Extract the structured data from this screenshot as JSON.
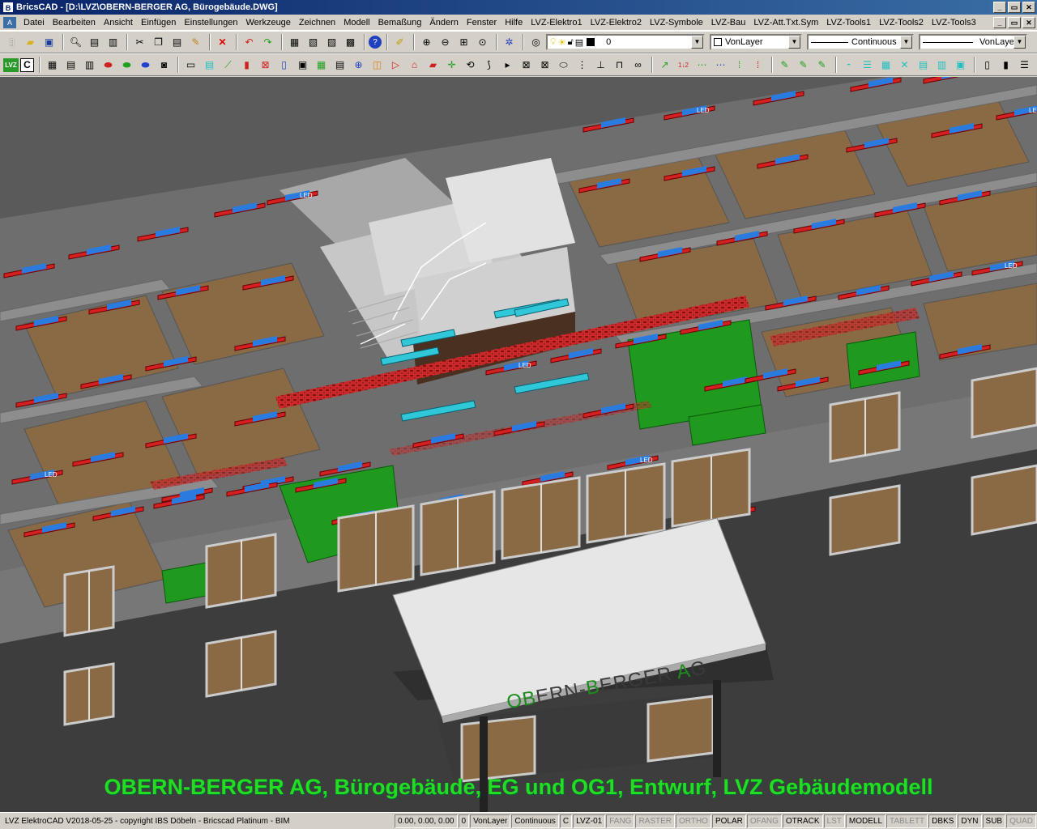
{
  "window": {
    "title": "BricsCAD - [D:\\LVZ\\OBERN-BERGER AG, Bürogebäude.DWG]"
  },
  "menu": {
    "items": [
      "Datei",
      "Bearbeiten",
      "Ansicht",
      "Einfügen",
      "Einstellungen",
      "Werkzeuge",
      "Zeichnen",
      "Modell",
      "Bemaßung",
      "Ändern",
      "Fenster",
      "Hilfe",
      "LVZ-Elektro1",
      "LVZ-Elektro2",
      "LVZ-Symbole",
      "LVZ-Bau",
      "LVZ-Att.Txt.Sym",
      "LVZ-Tools1",
      "LVZ-Tools2",
      "LVZ-Tools3"
    ]
  },
  "toolbar": {
    "layer_value": "0",
    "color_value": "VonLayer",
    "linetype_value": "Continuous",
    "lineweight_value": "VonLayer",
    "lvz_label": "LVZ",
    "c_label": "C"
  },
  "drawing": {
    "caption": "OBERN-BERGER AG, Bürogebäude, EG und OG1, Entwurf, LVZ Gebäudemodell",
    "sign_text": "OBERN-BERGER AG",
    "led_label": "LED"
  },
  "status": {
    "copyright": "LVZ ElektroCAD V2018-05-25 - copyright IBS Döbeln - Bricscad Platinum - BIM",
    "coords": "0.00, 0.00, 0.00",
    "layer": "0",
    "color": "VonLayer",
    "linetype": "Continuous",
    "c": "C",
    "style": "LVZ-01",
    "toggles": [
      {
        "label": "FANG",
        "on": false
      },
      {
        "label": "RASTER",
        "on": false
      },
      {
        "label": "ORTHO",
        "on": false
      },
      {
        "label": "POLAR",
        "on": true
      },
      {
        "label": "OFANG",
        "on": false
      },
      {
        "label": "OTRACK",
        "on": true
      },
      {
        "label": "LST",
        "on": false
      },
      {
        "label": "MODELL",
        "on": true
      },
      {
        "label": "TABLETT",
        "on": false
      },
      {
        "label": "DBKS",
        "on": true
      },
      {
        "label": "DYN",
        "on": true
      },
      {
        "label": "SUB",
        "on": true
      },
      {
        "label": "QUAD",
        "on": false
      }
    ]
  },
  "colors": {
    "title_gradient_start": "#0a246a",
    "title_gradient_end": "#3a6ea5",
    "chrome": "#d4d0c8",
    "caption": "#22dd22",
    "luminaire": "#d42020",
    "label_blue": "#2a7be0",
    "zone_green": "#1f9a1f",
    "floor_brown": "#8a6a45"
  },
  "icons": [
    "new-icon",
    "open-icon",
    "save-icon",
    "print-preview-icon",
    "print-icon",
    "plot-icon",
    "cut-icon",
    "copy-icon",
    "paste-icon",
    "match-properties-icon",
    "delete-icon",
    "undo-icon",
    "redo-icon",
    "properties-icon",
    "block-icon",
    "design-center-icon",
    "help-icon",
    "pan-icon",
    "zoom-in-icon",
    "zoom-out-icon",
    "zoom-window-icon",
    "zoom-extents-icon",
    "orbit-icon",
    "layer-manager-icon",
    "layer-state-icon"
  ]
}
